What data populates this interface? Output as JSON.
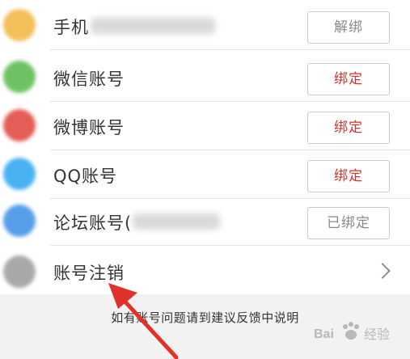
{
  "accounts": [
    {
      "label": "手机",
      "button": "解绑",
      "style": "grey",
      "icon": "phone-icon",
      "icon_color": "#f2b43c"
    },
    {
      "label": "微信账号",
      "button": "绑定",
      "style": "red",
      "icon": "wechat-icon",
      "icon_color": "#55b84a"
    },
    {
      "label": "微博账号",
      "button": "绑定",
      "style": "red",
      "icon": "weibo-icon",
      "icon_color": "#e0413a"
    },
    {
      "label": "QQ账号",
      "button": "绑定",
      "style": "red",
      "icon": "qq-icon",
      "icon_color": "#2aa4ee"
    },
    {
      "label": "论坛账号(",
      "button": "已绑定",
      "style": "grey",
      "icon": "forum-icon",
      "icon_color": "#3a8ee6"
    }
  ],
  "cancel_row": {
    "label": "账号注销",
    "icon": "power-icon",
    "icon_color": "#9a9a9a"
  },
  "footer_text": "如有账号问题请到建议反馈中说明",
  "watermark": {
    "text": "Bai 经验",
    "icon": "baidu-paw-icon"
  },
  "colors": {
    "accent_red": "#d9302b",
    "arrow_red": "#e0312b"
  }
}
